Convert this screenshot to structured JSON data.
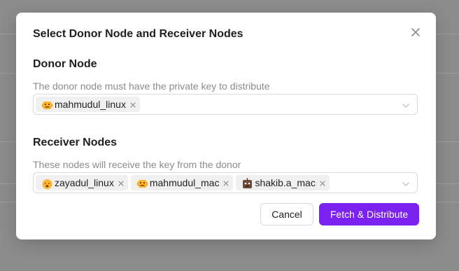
{
  "dialog": {
    "title": "Select Donor Node and Receiver Nodes"
  },
  "donor": {
    "title": "Donor Node",
    "help": "The donor node must have the private key to distribute",
    "tags": [
      {
        "label": "mahmudul_linux",
        "avatar": "robot-face-emoji-icon"
      }
    ]
  },
  "receivers": {
    "title": "Receiver Nodes",
    "help": "These nodes will receive the key from the donor",
    "tags": [
      {
        "label": "zayadul_linux",
        "avatar": "smiley-face-emoji-icon"
      },
      {
        "label": "mahmudul_mac",
        "avatar": "robot-face-emoji-icon"
      },
      {
        "label": "shakib.a_mac",
        "avatar": "brown-robot-emoji-icon"
      }
    ]
  },
  "actions": {
    "cancel_label": "Cancel",
    "primary_label": "Fetch & Distribute"
  },
  "colors": {
    "primary": "#7b22f0",
    "overlay": "#8c8c8c"
  }
}
